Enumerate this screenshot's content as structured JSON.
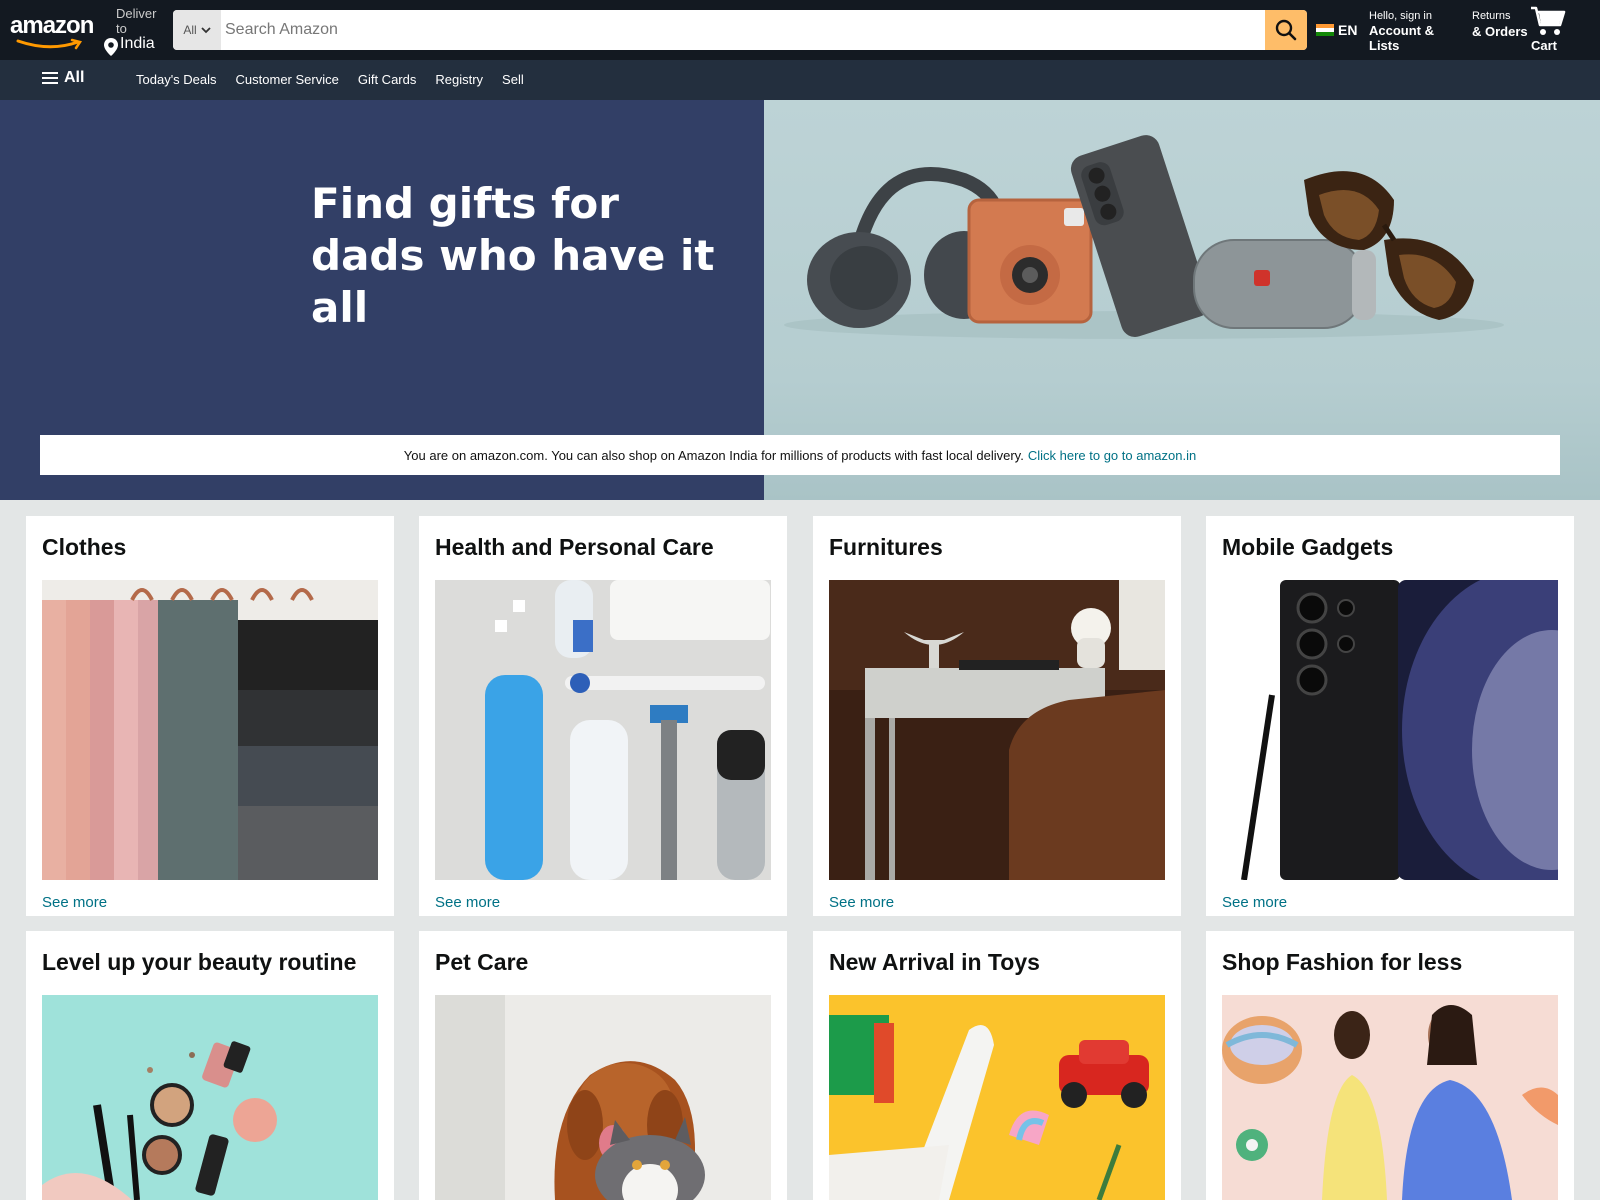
{
  "header": {
    "logo_text": "amazon",
    "deliver_line1": "Deliver",
    "deliver_line1b": "to",
    "deliver_country": "India",
    "search": {
      "category": "All",
      "placeholder": "Search Amazon"
    },
    "language": "EN",
    "account_hello": "Hello, sign in",
    "account_main": "Account & Lists",
    "returns_top": "Returns",
    "returns_main": "& Orders",
    "cart_label": "Cart"
  },
  "sub_nav": {
    "all_label": "All",
    "links": [
      "Today's Deals",
      "Customer Service",
      "Gift Cards",
      "Registry",
      "Sell"
    ]
  },
  "hero": {
    "title_line1": "Find gifts for",
    "title_line2": "dads who have it all"
  },
  "notice": {
    "text": "You are on amazon.com. You can also shop on Amazon India for millions of products with fast local delivery.",
    "link": "Click here to go to amazon.in"
  },
  "cards": [
    {
      "title": "Clothes",
      "more": "See more"
    },
    {
      "title": "Health and Personal Care",
      "more": "See more"
    },
    {
      "title": "Furnitures",
      "more": "See more"
    },
    {
      "title": "Mobile Gadgets",
      "more": "See more"
    },
    {
      "title": "Level up your beauty routine"
    },
    {
      "title": "Pet Care"
    },
    {
      "title": "New Arrival in Toys"
    },
    {
      "title": "Shop Fashion for less"
    }
  ],
  "colors": {
    "header_bg": "#131921",
    "subnav_bg": "#232f3e",
    "search_button": "#febd69",
    "link": "#007185",
    "hero_left": "#323f66",
    "page_bg": "#e3e6e6"
  }
}
